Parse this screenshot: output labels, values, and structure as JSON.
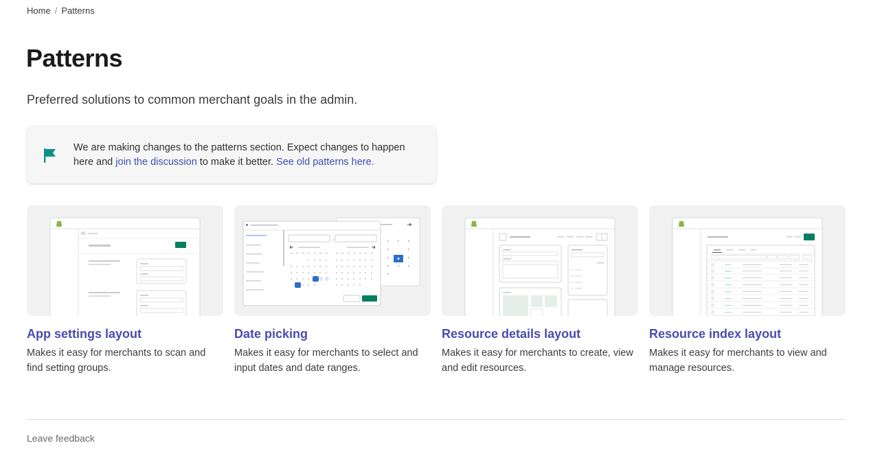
{
  "breadcrumb": {
    "home": "Home",
    "separator": "/",
    "current": "Patterns"
  },
  "page": {
    "title": "Patterns",
    "subtitle": "Preferred solutions to common merchant goals in the admin."
  },
  "banner": {
    "icon": "flag-icon",
    "text_before": "We are making changes to the patterns section. Expect changes to happen here and ",
    "link1": "join the discussion",
    "text_middle": " to make it better. ",
    "link2": "See old patterns here.",
    "accent": "#0e8f8a"
  },
  "cards": [
    {
      "title": "App settings layout",
      "description": "Makes it easy for merchants to scan and find setting groups."
    },
    {
      "title": "Date picking",
      "description": "Makes it easy for merchants to select and input dates and date ranges."
    },
    {
      "title": "Resource details layout",
      "description": "Makes it easy for merchants to create, view and edit resources."
    },
    {
      "title": "Resource index layout",
      "description": "Makes it easy for merchants to view and manage resources."
    }
  ],
  "footer": {
    "feedback": "Leave feedback"
  },
  "colors": {
    "link": "#4b4bb0",
    "primary_button": "#008060",
    "selected_date": "#2c6ecb"
  }
}
